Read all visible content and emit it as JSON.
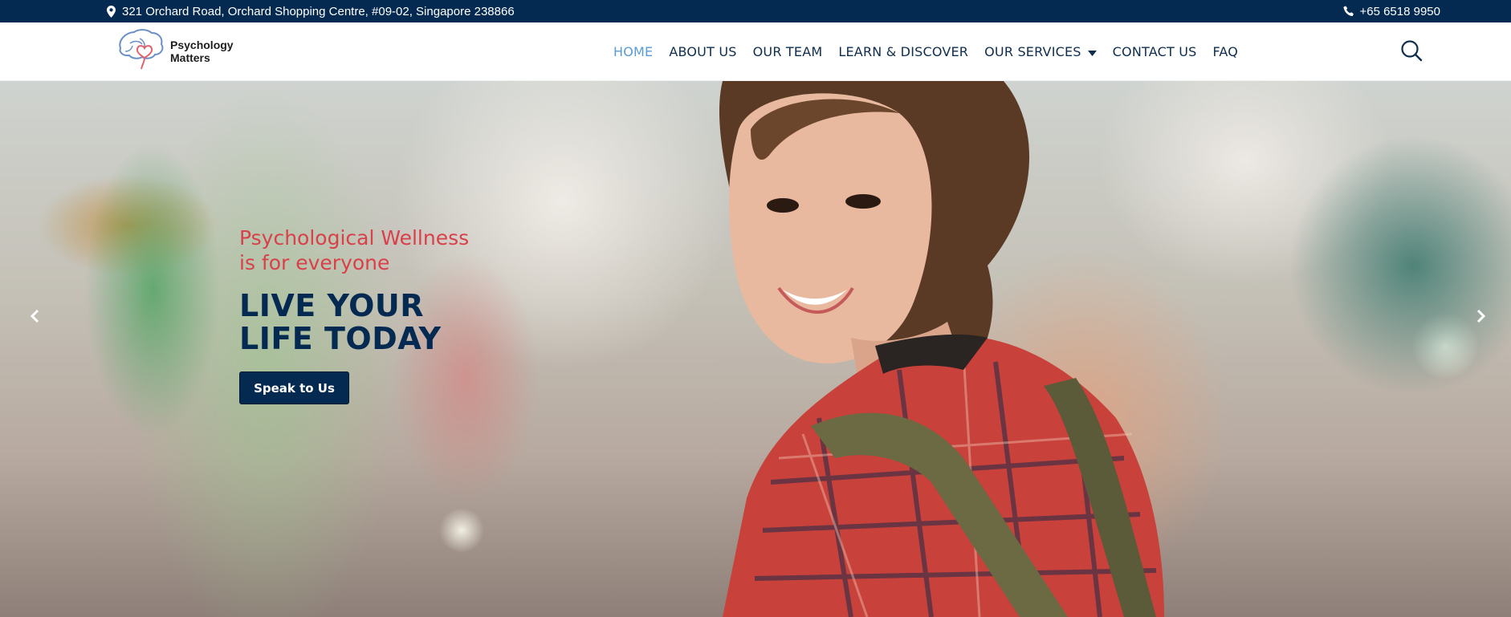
{
  "topbar": {
    "address": "321 Orchard Road, Orchard Shopping Centre, #09-02, Singapore 238866",
    "address_icon": "map-pin-icon",
    "phone": "+65 6518 9950",
    "phone_icon": "phone-icon",
    "background": "#052a51"
  },
  "logo": {
    "line1": "Psychology",
    "line2": "Matters"
  },
  "nav": {
    "items": [
      {
        "label": "HOME",
        "active": true
      },
      {
        "label": "ABOUT US"
      },
      {
        "label": "OUR TEAM"
      },
      {
        "label": "LEARN & DISCOVER"
      },
      {
        "label": "OUR SERVICES",
        "dropdown": true
      },
      {
        "label": "CONTACT US"
      },
      {
        "label": "FAQ"
      }
    ],
    "active_color": "#5a9bd4",
    "text_color": "#0f2d4d",
    "search_icon": "search-icon"
  },
  "hero": {
    "tagline_line1": "Psychological Wellness",
    "tagline_line2": "is for everyone",
    "headline_line1": "LIVE YOUR",
    "headline_line2": "LIFE TODAY",
    "cta_label": "Speak to Us",
    "tagline_color": "#d9404a",
    "headline_color": "#052a51",
    "prev_icon": "chevron-left-icon",
    "next_icon": "chevron-right-icon"
  }
}
